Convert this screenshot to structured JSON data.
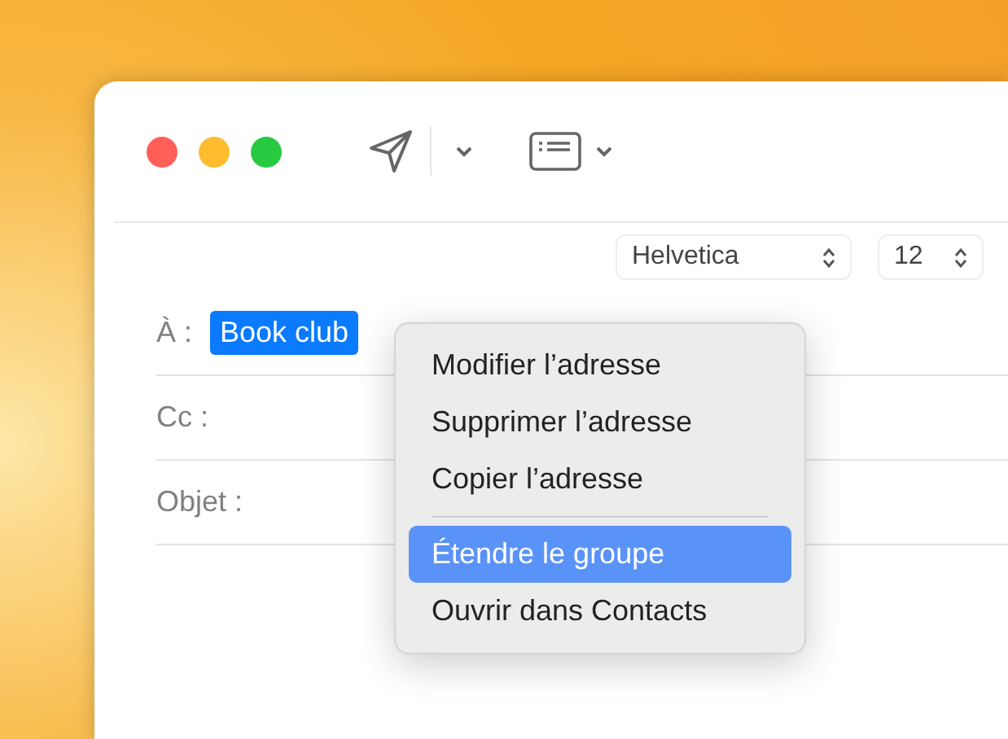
{
  "toolbar": {
    "font": "Helvetica",
    "size": "12"
  },
  "fields": [
    {
      "label": "À :",
      "token": "Book club"
    },
    {
      "label": "Cc :"
    },
    {
      "label": "Objet :"
    }
  ],
  "context_menu": {
    "items": [
      {
        "label": "Modifier l’adresse",
        "selected": false,
        "separator_before": false
      },
      {
        "label": "Supprimer l’adresse",
        "selected": false,
        "separator_before": false
      },
      {
        "label": "Copier l’adresse",
        "selected": false,
        "separator_before": false
      },
      {
        "label": "Étendre le groupe",
        "selected": true,
        "separator_before": true
      },
      {
        "label": "Ouvrir dans Contacts",
        "selected": false,
        "separator_before": false
      }
    ]
  }
}
